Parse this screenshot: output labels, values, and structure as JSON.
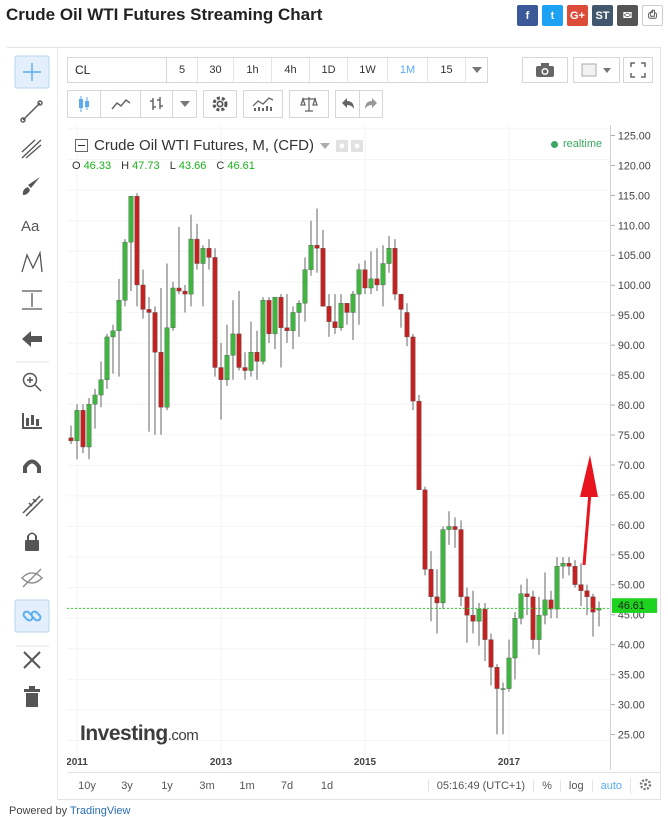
{
  "page": {
    "title": "Crude Oil WTI Futures Streaming Chart",
    "share_buttons": [
      {
        "icon": "facebook-icon",
        "glyph": "f",
        "color": "#3b5998"
      },
      {
        "icon": "twitter-icon",
        "glyph": "t",
        "color": "#1da1f2"
      },
      {
        "icon": "google-plus-icon",
        "glyph": "G+",
        "color": "#dd4b39"
      },
      {
        "icon": "stocktwits-icon",
        "glyph": "ST",
        "color": "#40576d"
      },
      {
        "icon": "email-icon",
        "glyph": "✉",
        "color": "#555555"
      },
      {
        "icon": "print-icon",
        "glyph": "⎙",
        "color": "#ffffff"
      }
    ]
  },
  "toolbar": {
    "symbol": "CL",
    "intervals": [
      "5",
      "30",
      "1h",
      "4h",
      "1D",
      "1W",
      "1M",
      "15"
    ],
    "active_interval": "1M"
  },
  "left_tools": [
    "crosshair-icon",
    "trend-line-icon",
    "pitchfork-icon",
    "brush-icon",
    "text-tool-icon",
    "pattern-icon",
    "measure-icon",
    "arrow-left-icon",
    "zoom-icon",
    "indicators-icon",
    "magnet-icon",
    "ruler-pen-icon",
    "lock-icon",
    "hide-icon",
    "link-icon",
    "settings-tools-icon",
    "trash-icon"
  ],
  "legend": {
    "title": "Crude Oil WTI Futures, M, (CFD)",
    "ohlc": {
      "O": "46.33",
      "H": "47.73",
      "L": "43.66",
      "C": "46.61"
    },
    "realtime": "realtime"
  },
  "watermark": {
    "brand": "Investing",
    "domain": ".com"
  },
  "bottom_bar": {
    "ranges": [
      "10y",
      "3y",
      "1y",
      "3m",
      "1m",
      "7d",
      "1d"
    ],
    "time": "05:16:49 (UTC+1)",
    "percent": "%",
    "log": "log",
    "auto": "auto"
  },
  "powered_by": {
    "prefix": "Powered by ",
    "link": "TradingView"
  },
  "colors": {
    "up": "#3cb83c",
    "down": "#c9201f",
    "accent": "#5aabf0",
    "current_price": "#1ed31e",
    "annotation_arrow": "#e8141e"
  },
  "chart_data": {
    "type": "candlestick",
    "title": "Crude Oil WTI Futures, M, (CFD)",
    "ylim": [
      21,
      125
    ],
    "y_ticks": [
      25,
      30,
      35,
      40,
      45,
      50,
      55,
      60,
      65,
      70,
      75,
      80,
      85,
      90,
      95,
      100,
      105,
      110,
      115,
      120,
      125
    ],
    "y_tick_labels": [
      "25.00",
      "30.00",
      "35.00",
      "40.00",
      "45.00",
      "50.00",
      "55.00",
      "60.00",
      "65.00",
      "70.00",
      "75.00",
      "80.00",
      "85.00",
      "90.00",
      "95.00",
      "100.00",
      "105.00",
      "110.00",
      "115.00",
      "120.00",
      "125.00"
    ],
    "x_labels": [
      "2011",
      "2013",
      "2015",
      "2017"
    ],
    "x_label_index": [
      1,
      25,
      49,
      73
    ],
    "current_price": 46.61,
    "current_price_label": "46.61",
    "annotation": "red upward arrow",
    "candles": [
      {
        "o": 74.5,
        "h": 76.5,
        "l": 73.5,
        "c": 74.0
      },
      {
        "o": 74.0,
        "h": 80.0,
        "l": 71.0,
        "c": 79.0
      },
      {
        "o": 79.0,
        "h": 80.0,
        "l": 72.0,
        "c": 73.0
      },
      {
        "o": 73.0,
        "h": 81.0,
        "l": 71.0,
        "c": 80.0
      },
      {
        "o": 80.0,
        "h": 82.5,
        "l": 76.0,
        "c": 81.5
      },
      {
        "o": 81.5,
        "h": 87.0,
        "l": 79.5,
        "c": 84.0
      },
      {
        "o": 84.0,
        "h": 91.5,
        "l": 82.5,
        "c": 91.0
      },
      {
        "o": 91.0,
        "h": 93.0,
        "l": 85.0,
        "c": 92.0
      },
      {
        "o": 92.0,
        "h": 100.5,
        "l": 84.5,
        "c": 97.0
      },
      {
        "o": 97.0,
        "h": 107.0,
        "l": 96.0,
        "c": 106.5
      },
      {
        "o": 106.5,
        "h": 114.0,
        "l": 98.5,
        "c": 114.0
      },
      {
        "o": 114.0,
        "h": 114.5,
        "l": 96.0,
        "c": 99.5
      },
      {
        "o": 99.5,
        "h": 102.0,
        "l": 94.0,
        "c": 95.5
      },
      {
        "o": 95.5,
        "h": 97.5,
        "l": 75.5,
        "c": 95.0
      },
      {
        "o": 95.0,
        "h": 96.0,
        "l": 75.0,
        "c": 88.5
      },
      {
        "o": 88.5,
        "h": 99.0,
        "l": 75.0,
        "c": 79.5
      },
      {
        "o": 79.5,
        "h": 103.0,
        "l": 79.0,
        "c": 92.5
      },
      {
        "o": 92.5,
        "h": 100.0,
        "l": 92.0,
        "c": 99.0
      },
      {
        "o": 99.0,
        "h": 109.0,
        "l": 98.0,
        "c": 98.5
      },
      {
        "o": 98.5,
        "h": 99.5,
        "l": 95.0,
        "c": 98.0
      },
      {
        "o": 98.0,
        "h": 111.0,
        "l": 96.0,
        "c": 107.0
      },
      {
        "o": 107.0,
        "h": 109.5,
        "l": 102.0,
        "c": 103.0
      },
      {
        "o": 103.0,
        "h": 106.0,
        "l": 96.0,
        "c": 105.5
      },
      {
        "o": 105.5,
        "h": 107.0,
        "l": 102.0,
        "c": 104.0
      },
      {
        "o": 104.0,
        "h": 105.5,
        "l": 84.5,
        "c": 86.0
      },
      {
        "o": 86.0,
        "h": 90.0,
        "l": 77.5,
        "c": 84.0
      },
      {
        "o": 84.0,
        "h": 93.0,
        "l": 83.0,
        "c": 88.0
      },
      {
        "o": 88.0,
        "h": 97.0,
        "l": 84.0,
        "c": 91.5
      },
      {
        "o": 91.5,
        "h": 98.5,
        "l": 85.5,
        "c": 86.0
      },
      {
        "o": 86.0,
        "h": 88.5,
        "l": 84.0,
        "c": 85.5
      },
      {
        "o": 85.5,
        "h": 93.5,
        "l": 84.5,
        "c": 88.5
      },
      {
        "o": 88.5,
        "h": 92.0,
        "l": 84.0,
        "c": 87.0
      },
      {
        "o": 87.0,
        "h": 97.5,
        "l": 86.5,
        "c": 97.0
      },
      {
        "o": 97.0,
        "h": 97.5,
        "l": 90.0,
        "c": 91.5
      },
      {
        "o": 91.5,
        "h": 97.5,
        "l": 89.0,
        "c": 97.5
      },
      {
        "o": 97.5,
        "h": 98.0,
        "l": 86.0,
        "c": 92.5
      },
      {
        "o": 92.5,
        "h": 98.0,
        "l": 90.0,
        "c": 92.0
      },
      {
        "o": 92.0,
        "h": 96.0,
        "l": 89.0,
        "c": 95.0
      },
      {
        "o": 95.0,
        "h": 97.0,
        "l": 91.0,
        "c": 96.5
      },
      {
        "o": 96.5,
        "h": 104.0,
        "l": 93.5,
        "c": 102.0
      },
      {
        "o": 102.0,
        "h": 110.0,
        "l": 101.0,
        "c": 106.0
      },
      {
        "o": 106.0,
        "h": 112.0,
        "l": 101.5,
        "c": 105.5
      },
      {
        "o": 105.5,
        "h": 108.5,
        "l": 101.0,
        "c": 96.0
      },
      {
        "o": 96.0,
        "h": 98.0,
        "l": 91.0,
        "c": 93.5
      },
      {
        "o": 93.5,
        "h": 98.0,
        "l": 91.5,
        "c": 92.5
      },
      {
        "o": 92.5,
        "h": 98.0,
        "l": 92.0,
        "c": 96.5
      },
      {
        "o": 96.5,
        "h": 96.0,
        "l": 93.0,
        "c": 95.0
      },
      {
        "o": 95.0,
        "h": 98.5,
        "l": 90.5,
        "c": 98.0
      },
      {
        "o": 98.0,
        "h": 103.0,
        "l": 93.0,
        "c": 102.0
      },
      {
        "o": 102.0,
        "h": 103.5,
        "l": 98.0,
        "c": 99.0
      },
      {
        "o": 99.0,
        "h": 105.0,
        "l": 98.0,
        "c": 100.5
      },
      {
        "o": 100.5,
        "h": 105.5,
        "l": 98.5,
        "c": 99.5
      },
      {
        "o": 99.5,
        "h": 106.0,
        "l": 96.0,
        "c": 103.0
      },
      {
        "o": 103.0,
        "h": 107.5,
        "l": 101.5,
        "c": 105.5
      },
      {
        "o": 105.5,
        "h": 107.0,
        "l": 97.0,
        "c": 98.0
      },
      {
        "o": 98.0,
        "h": 98.0,
        "l": 92.5,
        "c": 95.5
      },
      {
        "o": 95.0,
        "h": 96.5,
        "l": 89.5,
        "c": 91.0
      },
      {
        "o": 91.0,
        "h": 91.5,
        "l": 79.0,
        "c": 80.5
      },
      {
        "o": 80.5,
        "h": 81.5,
        "l": 67.5,
        "c": 66.0
      },
      {
        "o": 66.0,
        "h": 66.5,
        "l": 52.0,
        "c": 53.0
      },
      {
        "o": 53.0,
        "h": 56.0,
        "l": 44.5,
        "c": 48.5
      },
      {
        "o": 48.5,
        "h": 53.0,
        "l": 42.5,
        "c": 47.5
      },
      {
        "o": 47.5,
        "h": 60.0,
        "l": 46.5,
        "c": 59.5
      },
      {
        "o": 59.5,
        "h": 62.5,
        "l": 57.0,
        "c": 60.0
      },
      {
        "o": 60.0,
        "h": 61.5,
        "l": 56.5,
        "c": 59.5
      },
      {
        "o": 59.5,
        "h": 61.0,
        "l": 47.0,
        "c": 48.5
      },
      {
        "o": 48.5,
        "h": 50.0,
        "l": 41.0,
        "c": 45.5
      },
      {
        "o": 45.5,
        "h": 49.5,
        "l": 42.5,
        "c": 44.5
      },
      {
        "o": 44.5,
        "h": 47.5,
        "l": 40.5,
        "c": 46.5
      },
      {
        "o": 46.5,
        "h": 47.5,
        "l": 38.0,
        "c": 41.5
      },
      {
        "o": 41.5,
        "h": 42.5,
        "l": 34.0,
        "c": 37.0
      },
      {
        "o": 37.0,
        "h": 37.5,
        "l": 26.0,
        "c": 33.5
      },
      {
        "o": 33.5,
        "h": 34.5,
        "l": 26.0,
        "c": 33.5
      },
      {
        "o": 33.5,
        "h": 41.5,
        "l": 33.0,
        "c": 38.5
      },
      {
        "o": 38.5,
        "h": 46.0,
        "l": 35.0,
        "c": 45.0
      },
      {
        "o": 45.0,
        "h": 50.5,
        "l": 44.0,
        "c": 49.0
      },
      {
        "o": 49.0,
        "h": 51.5,
        "l": 45.5,
        "c": 48.5
      },
      {
        "o": 48.5,
        "h": 49.5,
        "l": 40.0,
        "c": 41.5
      },
      {
        "o": 41.5,
        "h": 48.5,
        "l": 39.0,
        "c": 45.5
      },
      {
        "o": 45.5,
        "h": 52.5,
        "l": 44.0,
        "c": 48.0
      },
      {
        "o": 48.0,
        "h": 49.5,
        "l": 45.0,
        "c": 46.5
      },
      {
        "o": 46.5,
        "h": 55.0,
        "l": 45.0,
        "c": 53.5
      },
      {
        "o": 53.5,
        "h": 55.0,
        "l": 51.5,
        "c": 54.0
      },
      {
        "o": 54.0,
        "h": 55.0,
        "l": 52.0,
        "c": 53.5
      },
      {
        "o": 53.5,
        "h": 54.5,
        "l": 50.0,
        "c": 50.5
      },
      {
        "o": 50.5,
        "h": 54.0,
        "l": 47.0,
        "c": 49.5
      },
      {
        "o": 49.5,
        "h": 50.5,
        "l": 45.5,
        "c": 48.5
      },
      {
        "o": 48.5,
        "h": 49.0,
        "l": 42.0,
        "c": 46.0
      },
      {
        "o": 46.33,
        "h": 47.73,
        "l": 43.66,
        "c": 46.61
      }
    ]
  }
}
